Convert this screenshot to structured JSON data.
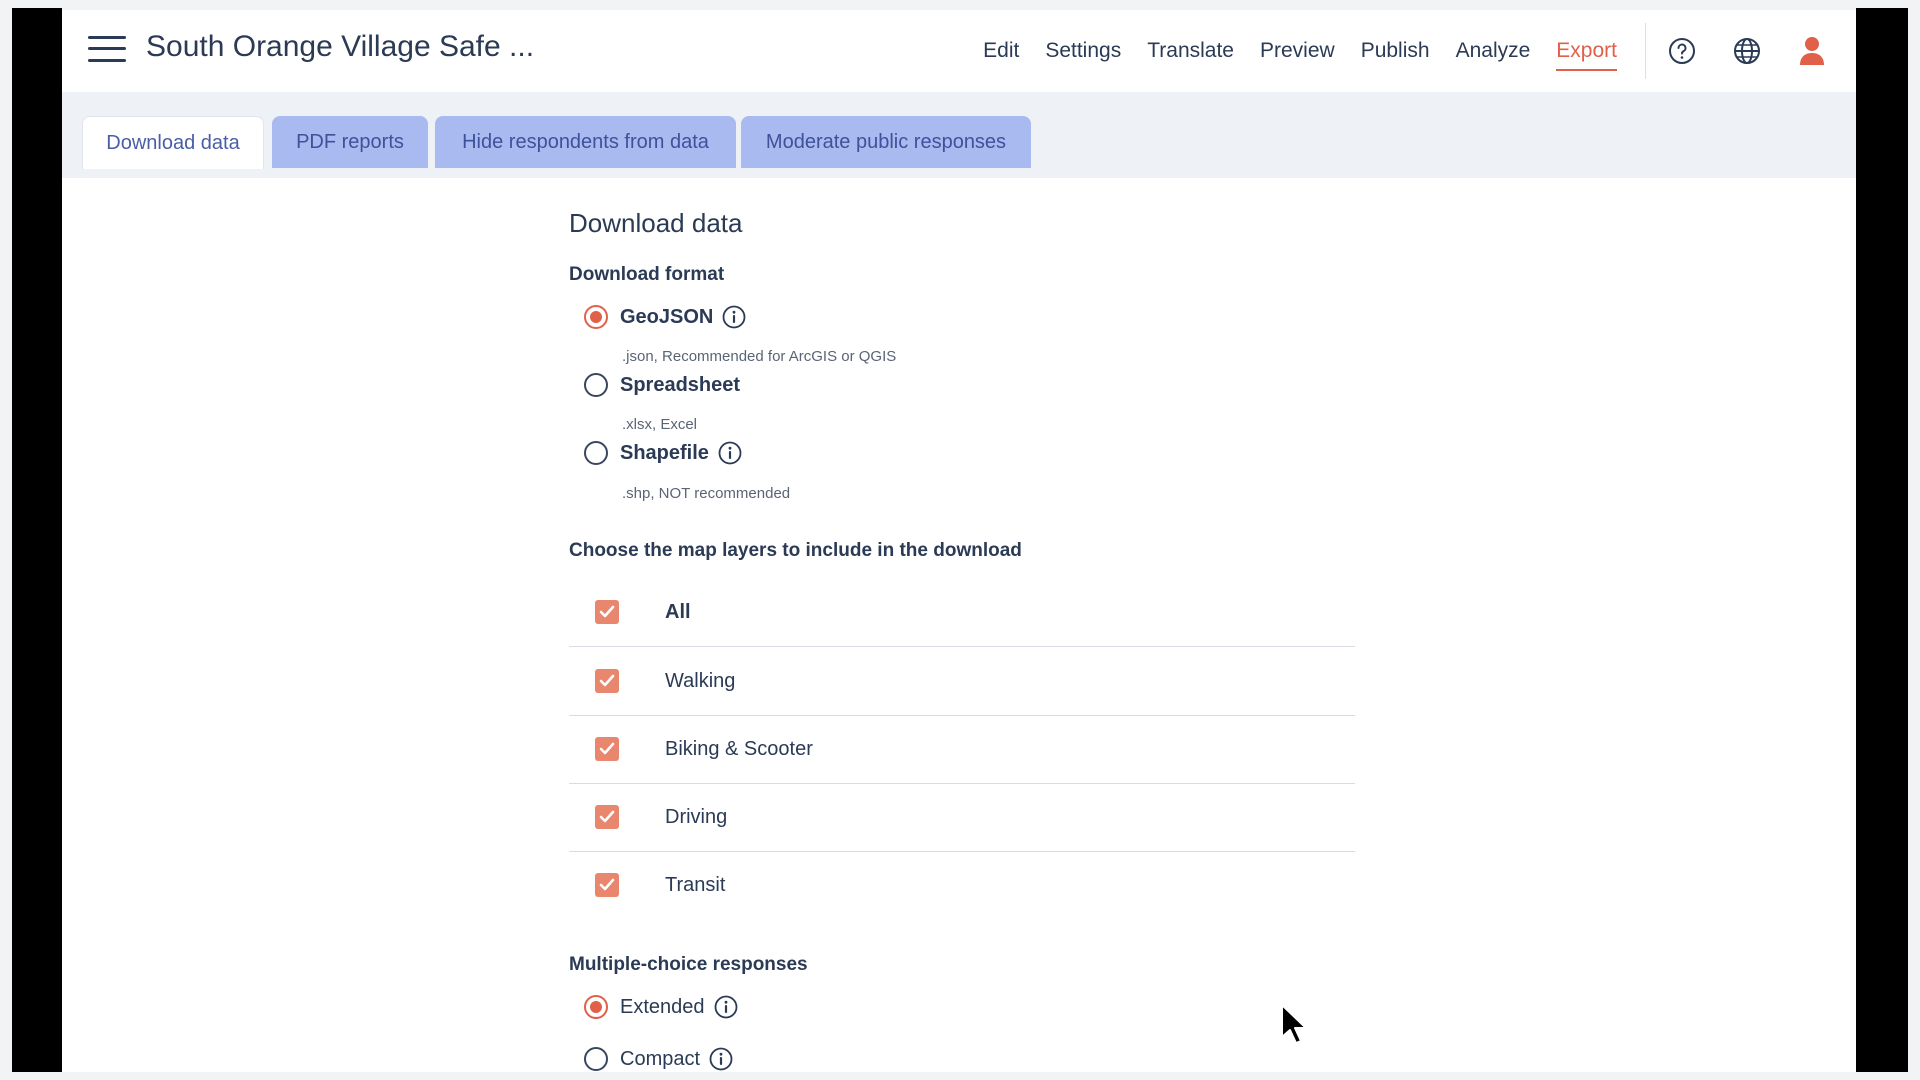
{
  "header": {
    "title": "South Orange Village Safe ...",
    "nav": [
      "Edit",
      "Settings",
      "Translate",
      "Preview",
      "Publish",
      "Analyze",
      "Export"
    ],
    "active_nav": "Export"
  },
  "tabs": [
    "Download data",
    "PDF reports",
    "Hide respondents from data",
    "Moderate public responses"
  ],
  "main": {
    "title": "Download data",
    "format_heading": "Download format",
    "formats": [
      {
        "label": "GeoJSON",
        "sub": ".json, Recommended for ArcGIS or QGIS",
        "selected": true
      },
      {
        "label": "Spreadsheet",
        "sub": ".xlsx, Excel",
        "selected": false
      },
      {
        "label": "Shapefile",
        "sub": ".shp, NOT recommended",
        "selected": false
      }
    ],
    "layers_heading": "Choose the map layers to include in the download",
    "layers": [
      {
        "label": "All",
        "checked": true
      },
      {
        "label": "Walking",
        "checked": true
      },
      {
        "label": "Biking & Scooter",
        "checked": true
      },
      {
        "label": "Driving",
        "checked": true
      },
      {
        "label": "Transit",
        "checked": true
      }
    ],
    "mc_heading": "Multiple-choice responses",
    "mc_options": [
      {
        "label": "Extended",
        "selected": true
      },
      {
        "label": "Compact",
        "selected": false
      }
    ]
  },
  "icons": {
    "menu": "hamburger-icon",
    "help": "help-icon",
    "language": "globe-icon",
    "account": "user-icon",
    "info": "info-icon",
    "check": "check-icon"
  },
  "colors": {
    "accent": "#e0604a",
    "checkbox": "#e9866e",
    "tab_inactive": "#a9baf0",
    "text": "#2b3a55"
  }
}
